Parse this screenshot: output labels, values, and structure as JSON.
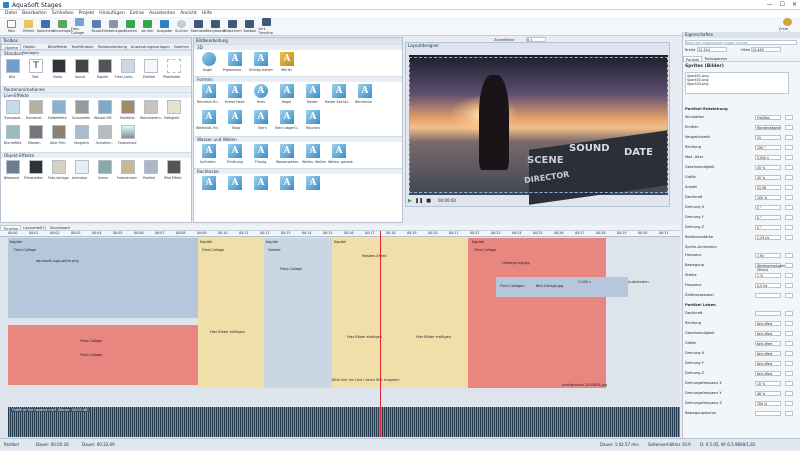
{
  "app": {
    "title": "AquaSoft Stages",
    "min": "—",
    "max": "☐",
    "close": "✕"
  },
  "menu": [
    "Datei",
    "Bearbeiten",
    "Schließen",
    "Projekt",
    "Hinzufügen",
    "Extras",
    "Assistenten",
    "Ansicht",
    "Hilfe"
  ],
  "toolbar": [
    "Neu",
    "Öffnen",
    "Speichern",
    "Hinzufügen",
    "Foto-Collage",
    "Musik",
    "Einstellungen",
    "Starten",
    "ab hier",
    "Ausgabe",
    "Suchen",
    "Standard",
    "Storyboard",
    "Bildschirm",
    "Toolbox",
    "Vert. Timeline"
  ],
  "toolbar_right": "Erste Schritte",
  "toolbox": {
    "title": "Toolbox",
    "tabs": [
      "Objekte",
      "Objekt-Vorlagen",
      "Bildeffekte",
      "Textfiltration",
      "Textbearbeitung",
      "Anwendungsvorlagen",
      "Galerien"
    ],
    "sections": [
      "Standard",
      "Routenanimationen",
      "Live-Effekte",
      "Objekt-Effekte"
    ],
    "std": [
      "Bild",
      "Text",
      "Video",
      "Sound",
      "Kapitel",
      "Flexi-Colla..",
      "Partikel",
      "Platzhalter"
    ],
    "live": [
      "Transpare..",
      "Kunstmal..",
      "Farbeffekte",
      "Graustufen",
      "Wasser-Eff..",
      "Holztöne",
      "Weichzeichn..",
      "Helligkeit"
    ],
    "live2": [
      "Blurreffekt",
      "Masken",
      "Alter Film",
      "Vergleich",
      "Schatten..",
      "Farbverlauf"
    ],
    "obj": [
      "Bildwand",
      "Filmstreifen",
      "Foto-Vorlage",
      "Animator",
      "Szene",
      "Fotorahmen",
      "Partikel",
      "iPad Effekt"
    ]
  },
  "gallery": {
    "title": "Bildbearbeitung",
    "sections": [
      "3D",
      "Formen",
      "Wasser und Wellen",
      "Rechtecke"
    ],
    "row1": [
      "Kugel",
      "Papierrasur",
      "Schräg stehen",
      "Würfel"
    ],
    "row2": [
      "Rechteck Rn.",
      "Kreise Hexe",
      "Kreis",
      "Kegel",
      "Raster",
      "Raster Kachel..",
      "Rechtecke"
    ],
    "row3": [
      "Wellenüb. Rn.",
      "Klipp",
      "Stern",
      "Stern abgerü..",
      "Wischen"
    ],
    "row4": [
      "Aufhellen",
      "Erhöhung",
      "Flüssig",
      "Wasserwellen",
      "Wellen. Wellen",
      "Wellen. gerade"
    ],
    "row5": [
      "Zoom"
    ]
  },
  "preview": {
    "title": "Layoutdesigner",
    "zoom": "Zoomfaktor",
    "zoom_val": "6 x",
    "time": "00:00:00",
    "scene_text": "SCENE",
    "sound_text": "SOUND",
    "date_text": "DATE",
    "director_text": "DIRECTOR"
  },
  "properties": {
    "title": "Eigenschaften",
    "search": "Nach den Allgemeinen fragen suchen",
    "w_label": "Breite",
    "w": "12.344",
    "h_label": "Höhe",
    "h": "13.480",
    "tabs": [
      "Partikel",
      "Trainsparens"
    ],
    "header": "Sprites (Bilder)",
    "files": [
      "Spark01.png",
      "Spark02.png",
      "Spark03.png"
    ],
    "section1": "Partikel-Entstehung",
    "rows1": [
      [
        "Simulation",
        "Frei/fest"
      ],
      [
        "Emitter",
        "Rechteckkante"
      ],
      [
        "Vergleichszeit",
        "15"
      ],
      [
        "Richtung",
        "190 °"
      ],
      [
        "Max. Alter",
        "5,000 s"
      ],
      [
        "Geschwindigkeit",
        "45 %"
      ],
      [
        "Größe",
        "40 %"
      ],
      [
        "Anzahl",
        "22,58"
      ],
      [
        "Deckkraft",
        "100 %"
      ],
      [
        "Drehung X",
        "0 °"
      ],
      [
        "Drehung Y",
        "0 °"
      ],
      [
        "Drehung Z",
        "0 °"
      ],
      [
        "Rotationsstärke",
        "2,29 r/s"
      ]
    ],
    "section2": "Sprite-Animation",
    "rows2": [
      [
        "Frequenz",
        "1 Hz"
      ],
      [
        "Bewegung",
        "Wellenschwingung (Sinus)"
      ],
      [
        "Stärke",
        "1 %"
      ],
      [
        "Frequenz",
        "0,5 Hz"
      ],
      [
        "Zeitlinieazaubei",
        ""
      ]
    ],
    "section3": "Partikel Leben",
    "rows3": [
      [
        "Deckkraft",
        ""
      ],
      [
        "Richtung",
        "Kein Wert"
      ],
      [
        "Geschwindigkeit",
        "Kein Wert"
      ],
      [
        "Größe",
        "Kein Wert"
      ],
      [
        "Drehung X",
        "Kein Wert"
      ],
      [
        "Drehung Y",
        "Kein Wert"
      ],
      [
        "Drehung Z",
        "Kein Wert"
      ],
      [
        "Drehungsfrequenz X",
        "10 %"
      ],
      [
        "Drehungsfrequenz Y",
        "48 %"
      ],
      [
        "Drehungsfrequenz Z",
        "784 %"
      ],
      [
        "Bewegungskurve",
        ""
      ]
    ],
    "buttons": [
      "Einfall",
      "Einfall"
    ]
  },
  "timeline": {
    "tabs": [
      "Timeline",
      "Layoutdef(?)",
      "Storyboard"
    ],
    "ruler": [
      "00:00",
      "00:01",
      "00:02",
      "00:03",
      "00:04",
      "00:05",
      "00:06",
      "00:07",
      "00:08",
      "00:09",
      "00:10",
      "00:11",
      "00:12",
      "00:13",
      "00:14",
      "00:15",
      "00:16",
      "00:17",
      "00:18",
      "00:19",
      "00:20",
      "00:21",
      "00:22",
      "00:23",
      "00:24",
      "00:25",
      "00:26",
      "00:27",
      "00:28",
      "00:29",
      "00:30",
      "00:31"
    ],
    "tracks": [
      "Kapitel",
      "Flexi-Collage",
      "aquasoft-logo-white.png",
      "Flexi-Collage",
      "Flexi-Collage",
      "Kapitel",
      "Flexi-Collage",
      "Kapitel",
      "Galerie",
      "Flexi-Collage",
      "Kapitel",
      "Masken-Effekt",
      "Kapitel",
      "Flexi-Collage",
      "Hintergrund.jpg",
      "Flexi-Collagen",
      "Bild-Collage.jpg",
      "Hier Bilder einfügen",
      "Hier Bilder einfügen",
      "Hier Bilder einfügen",
      "shutterstock.2053836.jpg",
      "Partikel"
    ],
    "caption": "Bitte hier ein Lied / einen Text eingeben",
    "audio": "Outfit of the Legend.mp3 (Dauer: 00:03:48)",
    "len": "2,000 s",
    "fade": "Ausblenden"
  },
  "status": {
    "left": "Partikel",
    "dur": "Dauer: 00:05:16",
    "total": "Dauer: 00:32.09",
    "right1": "Dauer: 1:42.57 min",
    "right2": "Seitenverhältnis 16:9",
    "right3": "D: 0.5.05, W: 6.5,9600/1,82"
  }
}
